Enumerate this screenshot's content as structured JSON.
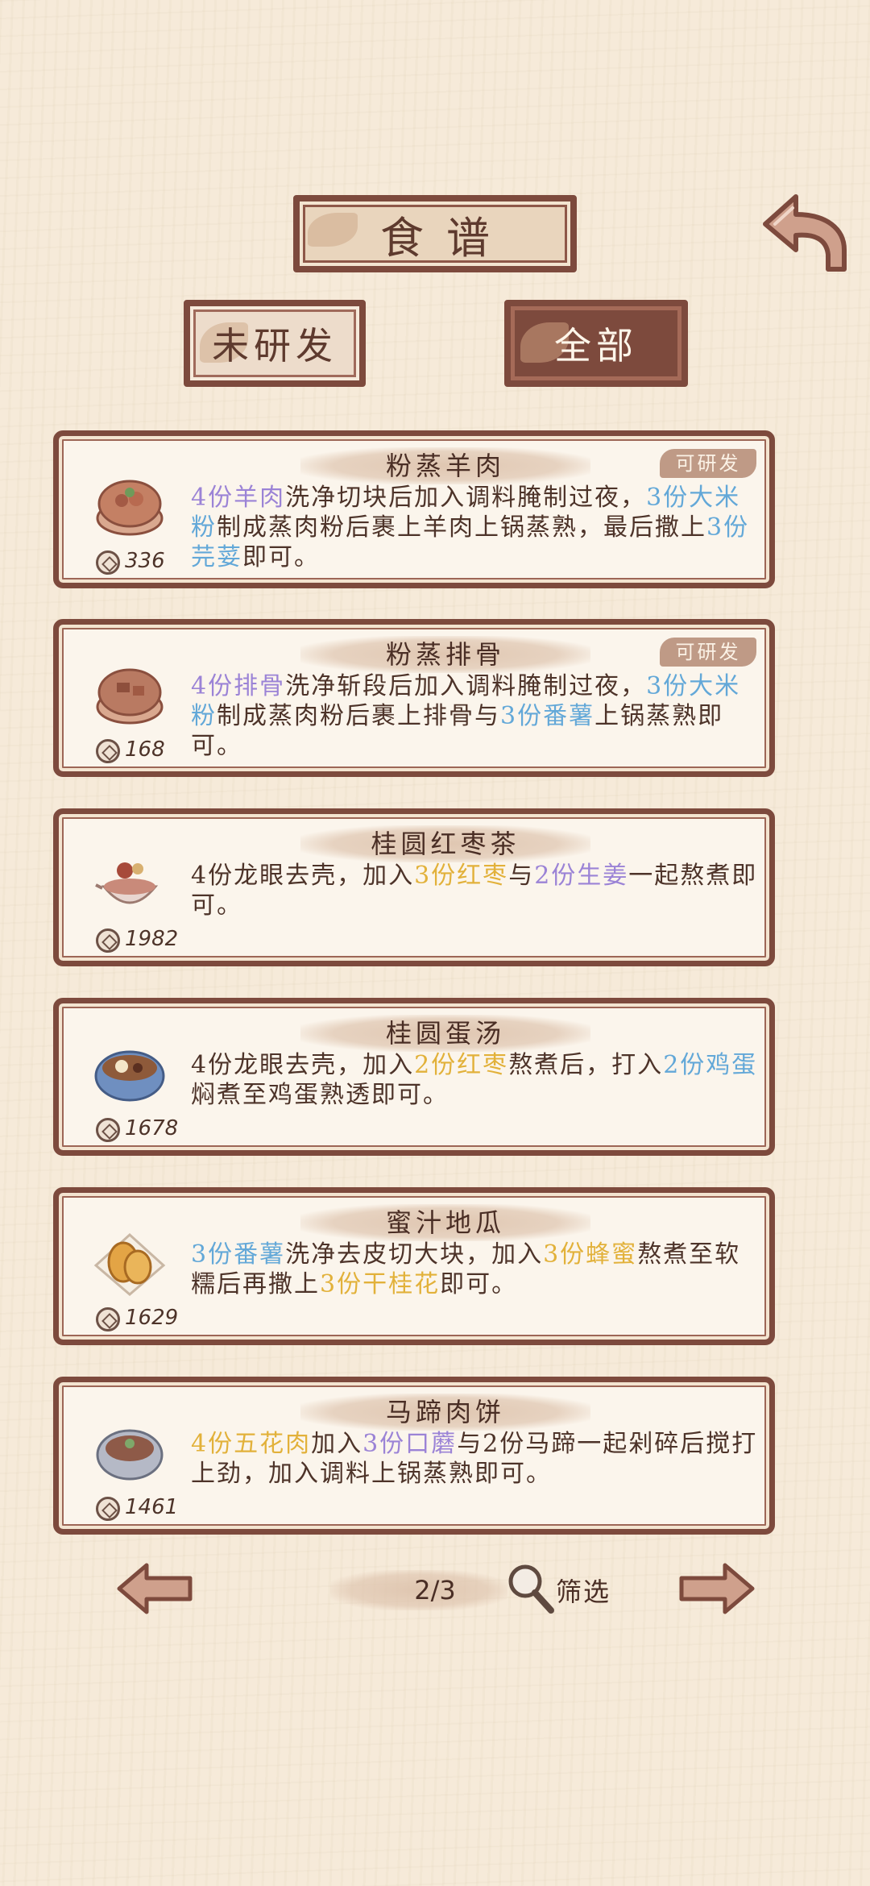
{
  "header": {
    "title": "食谱",
    "tab_undeveloped": "未研发",
    "tab_all": "全部"
  },
  "recipes": [
    {
      "name": "粉蒸羊肉",
      "badge": "可研发",
      "price": "336",
      "icon": "steamed-lamb-icon",
      "desc": [
        {
          "t": "4份羊肉",
          "c": "purple"
        },
        {
          "t": "洗净切块后加入调料腌制过夜，",
          "c": ""
        },
        {
          "t": "3份大米粉",
          "c": "blue"
        },
        {
          "t": "制成蒸肉粉后裹上羊肉上锅蒸熟，最后撒上",
          "c": ""
        },
        {
          "t": "3份芫荽",
          "c": "blue"
        },
        {
          "t": "即可。",
          "c": ""
        }
      ]
    },
    {
      "name": "粉蒸排骨",
      "badge": "可研发",
      "price": "168",
      "icon": "steamed-ribs-icon",
      "desc": [
        {
          "t": "4份排骨",
          "c": "purple"
        },
        {
          "t": "洗净斩段后加入调料腌制过夜，",
          "c": ""
        },
        {
          "t": "3份大米粉",
          "c": "blue"
        },
        {
          "t": "制成蒸肉粉后裹上排骨与",
          "c": ""
        },
        {
          "t": "3份番薯",
          "c": "blue"
        },
        {
          "t": "上锅蒸熟即可。",
          "c": ""
        }
      ]
    },
    {
      "name": "桂圆红枣茶",
      "badge": "",
      "price": "1982",
      "icon": "longan-tea-icon",
      "desc": [
        {
          "t": "4份龙眼去壳，加入",
          "c": ""
        },
        {
          "t": "3份红枣",
          "c": "yellow"
        },
        {
          "t": "与",
          "c": ""
        },
        {
          "t": "2份生姜",
          "c": "purple"
        },
        {
          "t": "一起熬煮即可。",
          "c": ""
        }
      ]
    },
    {
      "name": "桂圆蛋汤",
      "badge": "",
      "price": "1678",
      "icon": "longan-egg-soup-icon",
      "desc": [
        {
          "t": "4份龙眼去壳，加入",
          "c": ""
        },
        {
          "t": "2份红枣",
          "c": "yellow"
        },
        {
          "t": "熬煮后，打入",
          "c": ""
        },
        {
          "t": "2份鸡蛋",
          "c": "blue"
        },
        {
          "t": "焖煮至鸡蛋熟透即可。",
          "c": ""
        }
      ]
    },
    {
      "name": "蜜汁地瓜",
      "badge": "",
      "price": "1629",
      "icon": "honey-sweet-potato-icon",
      "desc": [
        {
          "t": "3份番薯",
          "c": "blue"
        },
        {
          "t": "洗净去皮切大块，加入",
          "c": ""
        },
        {
          "t": "3份蜂蜜",
          "c": "yellow"
        },
        {
          "t": "熬煮至软糯后再撒上",
          "c": ""
        },
        {
          "t": "3份干桂花",
          "c": "yellow"
        },
        {
          "t": "即可。",
          "c": ""
        }
      ]
    },
    {
      "name": "马蹄肉饼",
      "badge": "",
      "price": "1461",
      "icon": "water-chestnut-patty-icon",
      "desc": [
        {
          "t": "4份五花肉",
          "c": "yellow"
        },
        {
          "t": "加入",
          "c": ""
        },
        {
          "t": "3份口蘑",
          "c": "purple"
        },
        {
          "t": "与2份马蹄一起剁碎后搅打上劲，加入调料上锅蒸熟即可。",
          "c": ""
        }
      ]
    }
  ],
  "pagination": {
    "page": "2/3",
    "filter_label": "筛选"
  },
  "colors": {
    "frame": "#7d4a3d",
    "background": "#f6ead9",
    "highlight_purple": "#9b83d6",
    "highlight_blue": "#63a8d8",
    "highlight_yellow": "#e2b13a"
  }
}
